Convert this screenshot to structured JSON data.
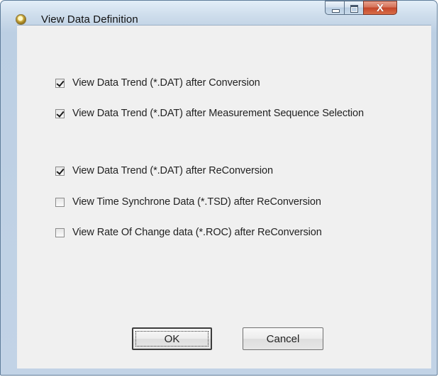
{
  "window": {
    "title": "View Data Definition",
    "close_glyph": "X"
  },
  "options": [
    {
      "label": "View Data Trend  (*.DAT) after Conversion",
      "checked": true
    },
    {
      "label": "View Data Trend  (*.DAT) after Measurement Sequence Selection",
      "checked": true
    },
    {
      "label": "View Data Trend  (*.DAT) after ReConversion",
      "checked": true
    },
    {
      "label": "View Time Synchrone Data  (*.TSD) after ReConversion",
      "checked": false
    },
    {
      "label": "View Rate Of Change data  (*.ROC) after ReConversion",
      "checked": false
    }
  ],
  "buttons": {
    "ok_label": "OK",
    "cancel_label": "Cancel"
  }
}
